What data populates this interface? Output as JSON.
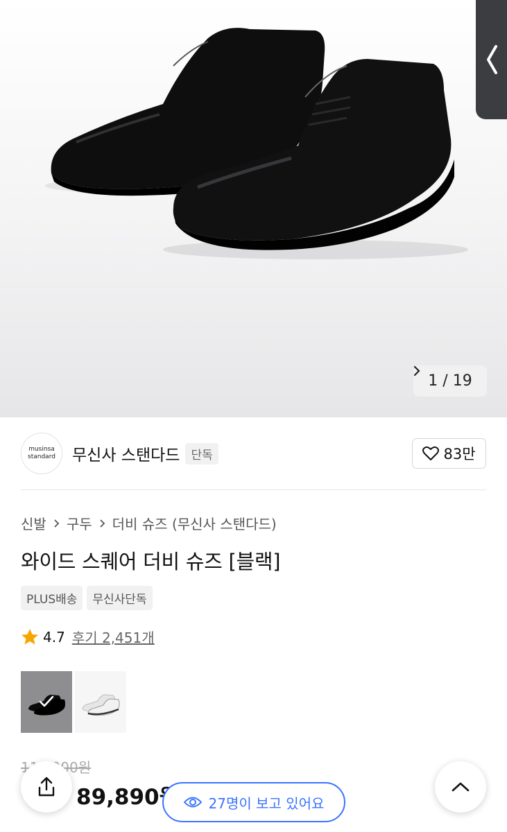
{
  "gallery": {
    "current": "1",
    "total": "19",
    "separator": "/"
  },
  "brand": {
    "logo_line1": "musinsa",
    "logo_line2": "standard",
    "name": "무신사 스탠다드",
    "tag": "단독",
    "likes": "83만"
  },
  "breadcrumb": [
    "신발",
    "구두",
    "더비 슈즈 (무신사 스탠다드)"
  ],
  "product": {
    "title": "와이드 스퀘어 더비 슈즈 [블랙]",
    "tags": [
      "PLUS배송",
      "무신사단독"
    ],
    "rating": "4.7",
    "reviews": "후기 2,451개",
    "original_price": "119,900원",
    "sale_price": "89,890원"
  },
  "colors": [
    "black",
    "white"
  ],
  "viewers_text": "27명이 보고 있어요",
  "icons": [
    "chevron-left-icon",
    "chevron-right-icon",
    "heart-icon",
    "star-icon",
    "check-icon",
    "share-icon",
    "chevron-up-icon",
    "eye-icon"
  ],
  "accent": "#3a73ff",
  "star_color": "#f7a600",
  "sale_color": "#ff3b30"
}
